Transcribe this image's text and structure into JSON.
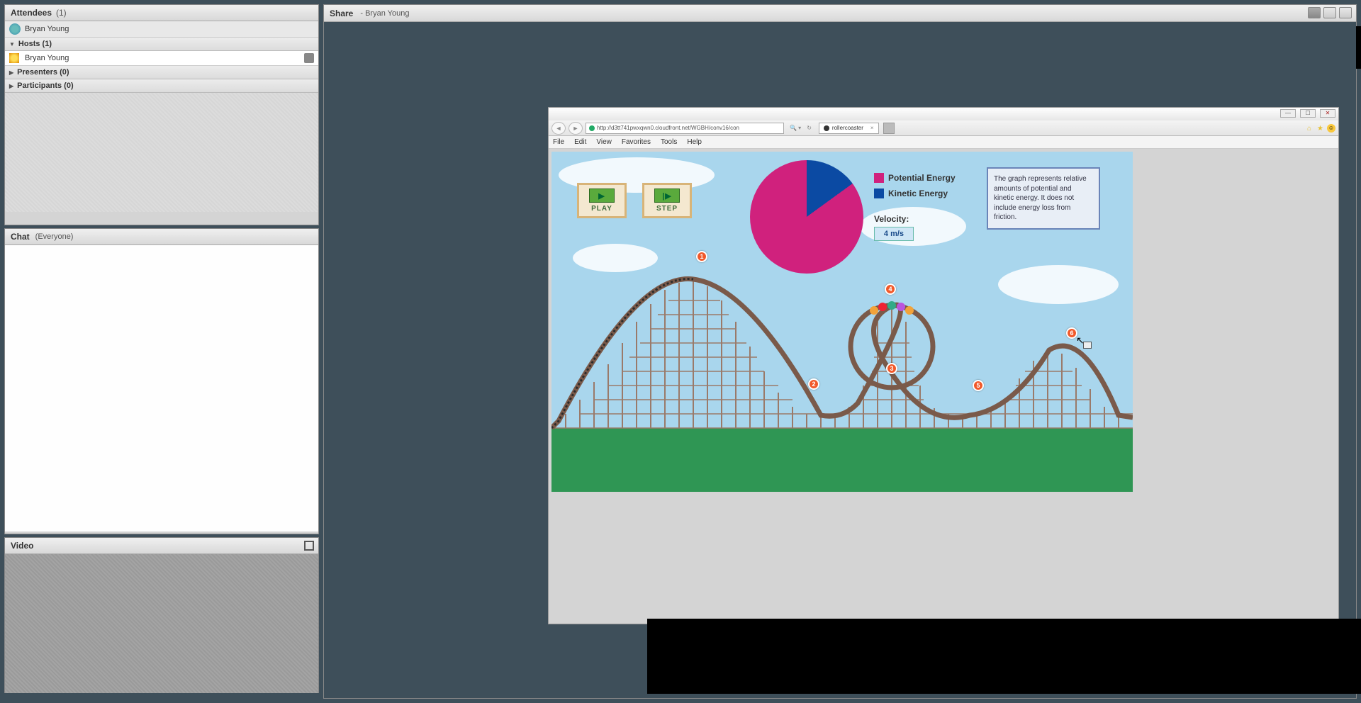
{
  "attendees": {
    "title": "Attendees",
    "count": "(1)",
    "self_name": "Bryan Young",
    "groups": {
      "hosts": {
        "label": "Hosts (1)",
        "member": "Bryan Young"
      },
      "presenters": {
        "label": "Presenters (0)"
      },
      "participants": {
        "label": "Participants (0)"
      }
    }
  },
  "chat": {
    "title": "Chat",
    "scope": "(Everyone)"
  },
  "video": {
    "title": "Video"
  },
  "share": {
    "title": "Share",
    "presenter": "- Bryan Young"
  },
  "browser": {
    "url": "http://d3tt741pwxqwn0.cloudfront.net/WGBH/conv16/con",
    "tab_title": "rollercoaster",
    "menus": [
      "File",
      "Edit",
      "View",
      "Favorites",
      "Tools",
      "Help"
    ],
    "window_controls": {
      "min": "—",
      "max": "☐",
      "close": "✕"
    }
  },
  "sim": {
    "play": "PLAY",
    "step": "STEP",
    "legend_pe": "Potential Energy",
    "legend_ke": "Kinetic Energy",
    "velocity_label": "Velocity:",
    "velocity_value": "4 m/s",
    "info": "The graph represents relative amounts of potential and kinetic energy. It does not include energy loss from friction.",
    "markers": [
      "1",
      "2",
      "3",
      "4",
      "5",
      "6"
    ]
  },
  "chart_data": {
    "type": "pie",
    "title": "",
    "series": [
      {
        "name": "Potential Energy",
        "value": 85,
        "color": "#d0217d"
      },
      {
        "name": "Kinetic Energy",
        "value": 15,
        "color": "#0b4aa3"
      }
    ],
    "velocity_m_per_s": 4
  }
}
